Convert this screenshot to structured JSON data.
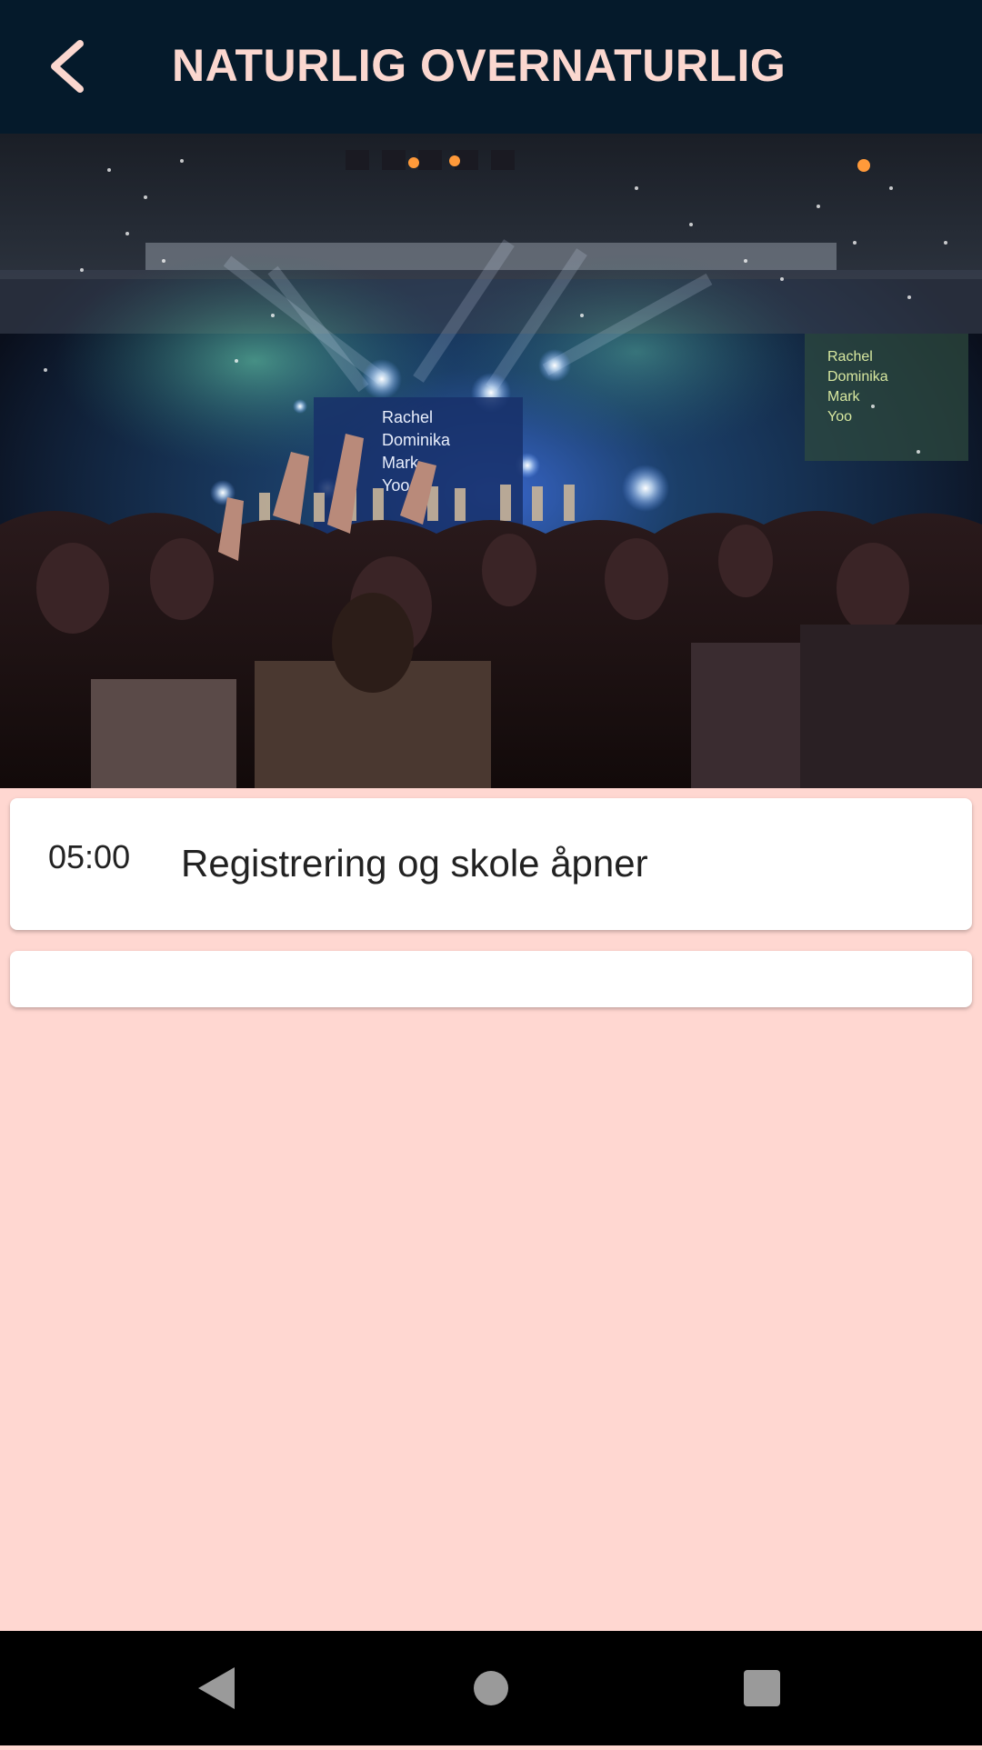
{
  "app_bar": {
    "title": "NATURLIG OVERNATURLIG",
    "back_icon": "chevron-left-icon"
  },
  "hero": {
    "screen_lines": [
      "Rachel",
      "Dominika",
      "Mark",
      "Yoo"
    ],
    "side_screen_lines": [
      "Rachel",
      "Dominika",
      "Mark",
      "Yoo"
    ]
  },
  "schedule": {
    "items": [
      {
        "time": "05:00",
        "title": "Registrering og skole åpner"
      },
      {
        "time": "",
        "title": ""
      }
    ]
  },
  "nav": {
    "back_icon": "triangle-back-icon",
    "home_icon": "circle-home-icon",
    "recents_icon": "square-recents-icon"
  },
  "colors": {
    "app_bar_bg": "#051a2b",
    "title_color": "#fbd7cf",
    "page_bg": "#ffd7d1",
    "card_bg": "#ffffff",
    "nav_bg": "#000000"
  }
}
